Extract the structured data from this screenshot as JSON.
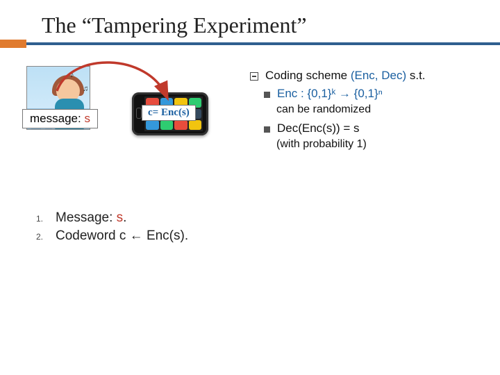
{
  "title": "The “Tampering Experiment”",
  "diagram": {
    "message_label_prefix": "message: ",
    "message_label_var": "s",
    "code_label": "c= Enc(s)"
  },
  "scheme": {
    "lead": "Coding scheme ",
    "tuple": "(Enc, Dec)",
    "tail": " s.t.",
    "enc_line": "Enc : {0,1}ᵏ → {0,1}ⁿ",
    "enc_note": "can be randomized",
    "dec_line": "Dec(Enc(s)) = s",
    "dec_note": "(with probability 1)"
  },
  "steps": {
    "n1": "1.",
    "line1_a": "Message: ",
    "line1_b": "s",
    "line1_c": ".",
    "n2": "2.",
    "line2": "Codeword c ← Enc(s)."
  }
}
